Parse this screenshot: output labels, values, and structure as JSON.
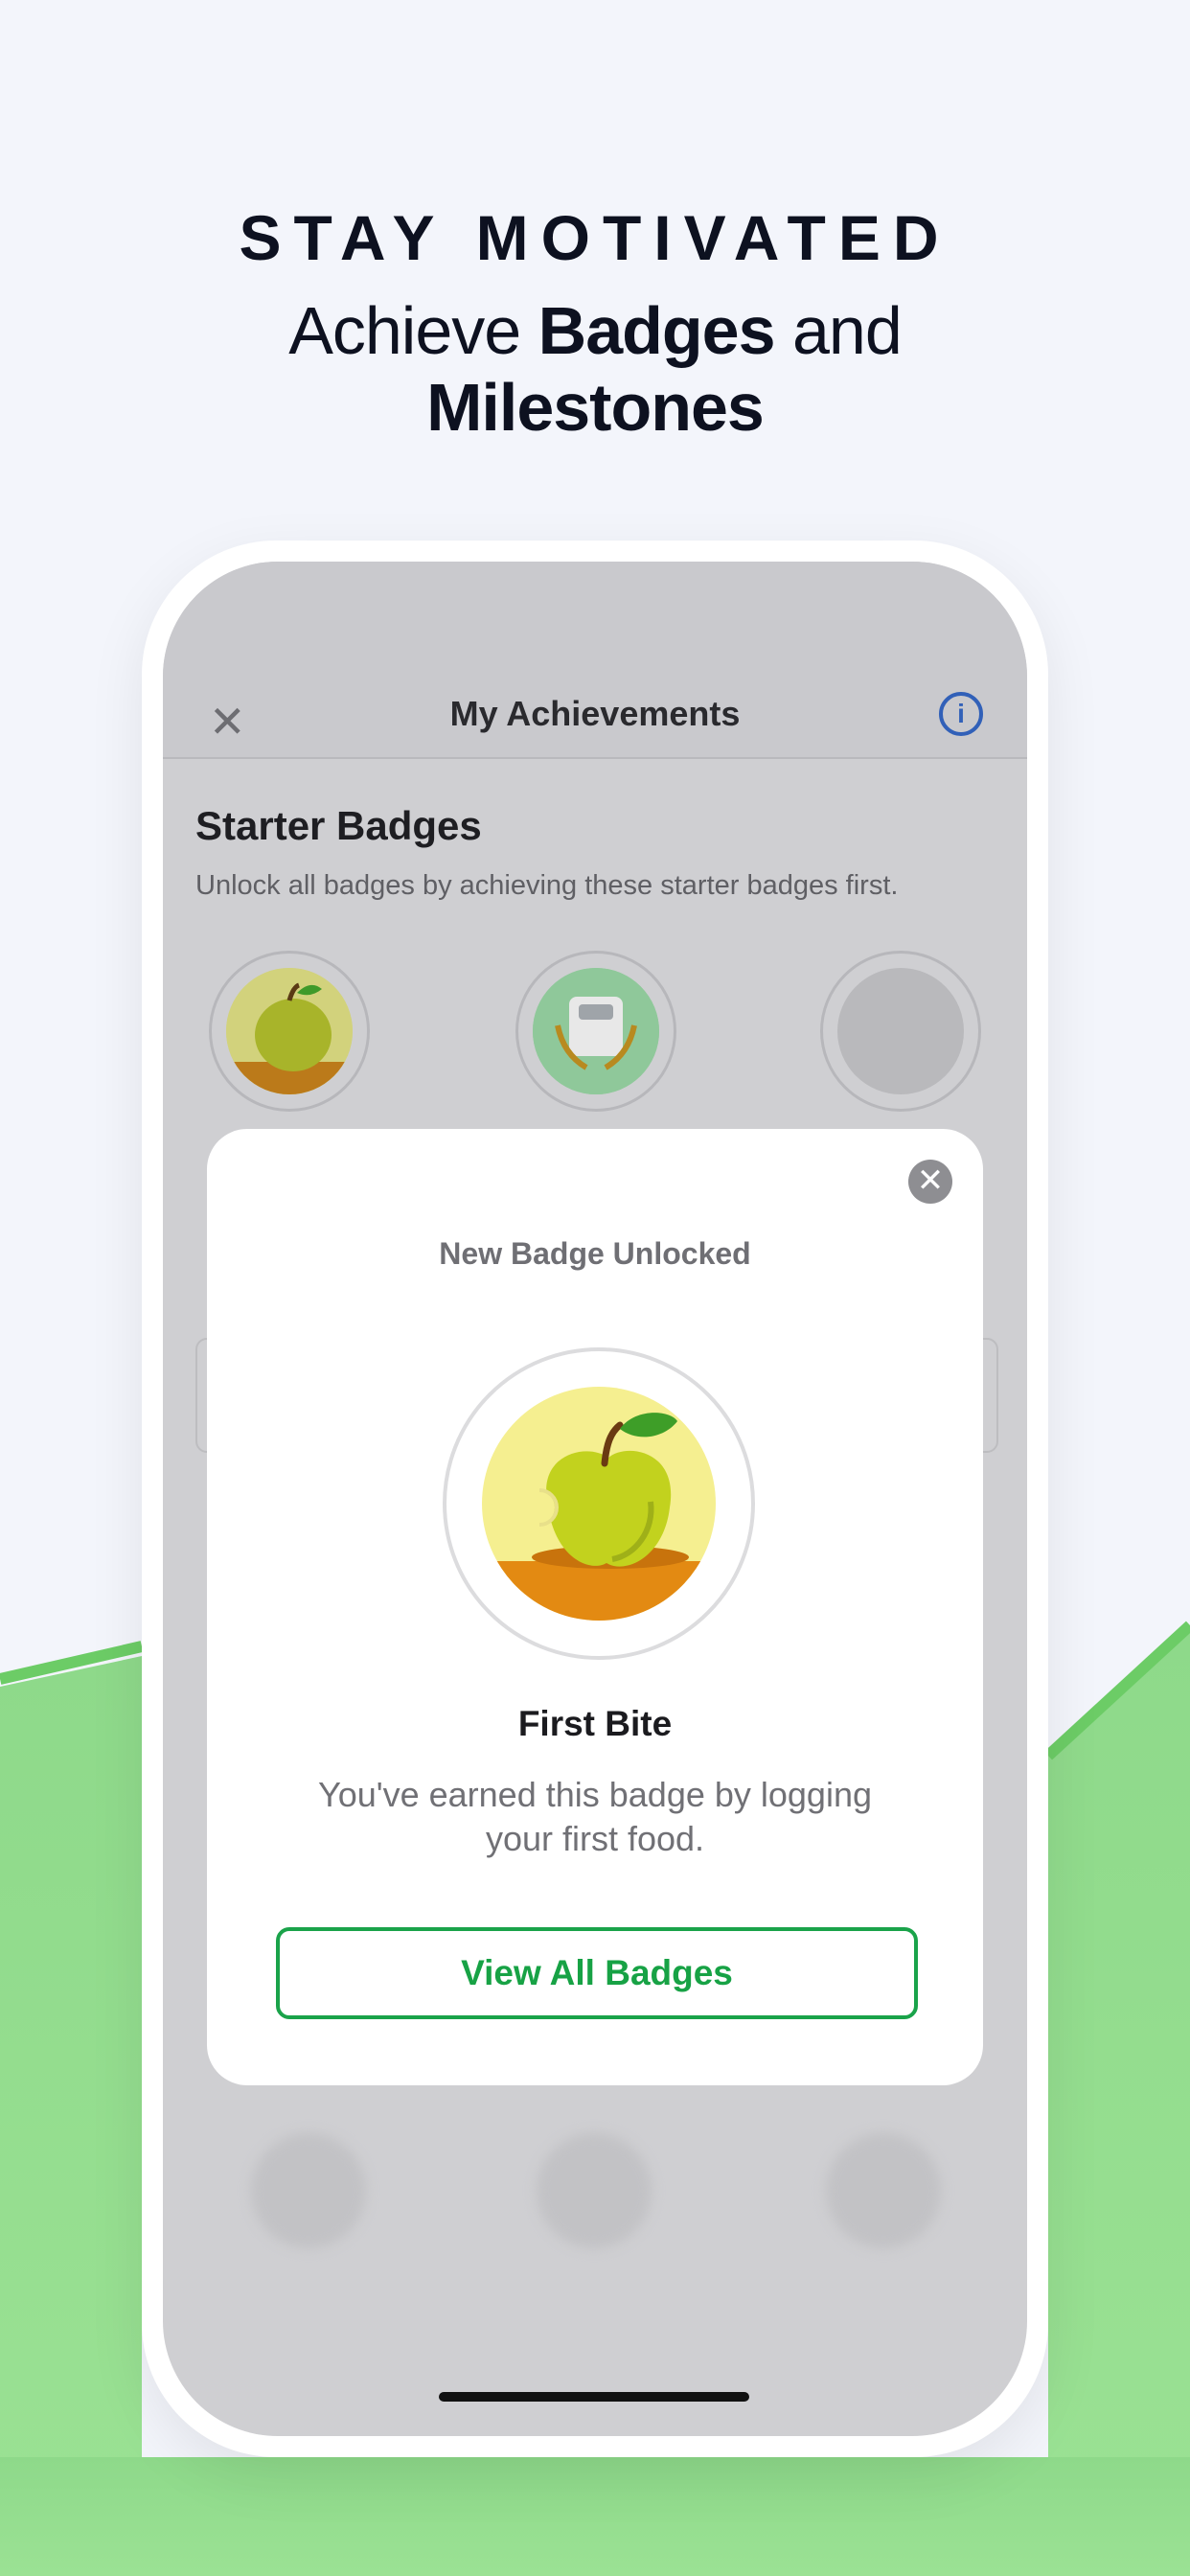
{
  "hero": {
    "eyebrow": "STAY MOTIVATED",
    "headline_part1": "Achieve ",
    "headline_bold1": "Badges",
    "headline_part2": " and",
    "headline_bold2": "Milestones"
  },
  "app": {
    "nav": {
      "close_icon": "close-icon",
      "title": "My Achievements",
      "info_icon": "info-icon",
      "info_glyph": "i"
    },
    "section": {
      "title": "Starter Badges",
      "subtitle": "Unlock all badges by achieving these starter badges first."
    },
    "starter_badges": [
      {
        "icon": "apple-badge-icon",
        "state": "unlocked"
      },
      {
        "icon": "scale-badge-icon",
        "state": "unlocked"
      },
      {
        "icon": "locked-badge-icon",
        "state": "locked"
      }
    ]
  },
  "modal": {
    "close_icon": "close-icon",
    "kicker": "New Badge Unlocked",
    "badge_icon": "apple-badge-icon",
    "title": "First Bite",
    "body": "You've earned this badge by logging your first food.",
    "cta": "View All Badges"
  },
  "colors": {
    "accent_green": "#1aa34a",
    "info_blue": "#3160b8",
    "wave_green": "#8ed98a",
    "background": "#f3f5fb"
  }
}
